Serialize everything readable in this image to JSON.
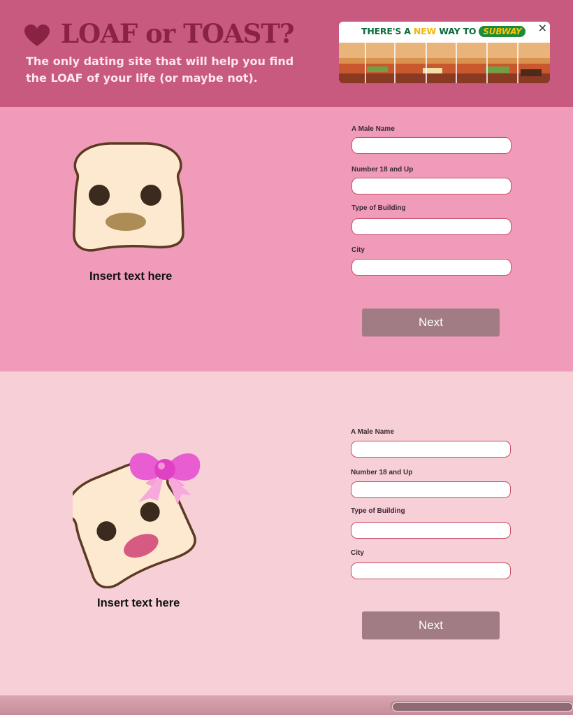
{
  "header": {
    "title": "LOAF or TOAST?",
    "tagline": "The only dating site that will help you find the LOAF of your life (or maybe not)."
  },
  "ad": {
    "headline_part1": "THERE'S A ",
    "headline_new": "NEW",
    "headline_part2": " WAY TO",
    "brand": "SUBWAY",
    "close_label": "×"
  },
  "forms": [
    {
      "caption": "Insert text here",
      "fields": [
        {
          "label": "A Male Name",
          "value": ""
        },
        {
          "label": "Number 18 and Up",
          "value": ""
        },
        {
          "label": "Type of Building",
          "value": ""
        },
        {
          "label": "City",
          "value": ""
        }
      ],
      "button_label": "Next"
    },
    {
      "caption": "Insert text here",
      "fields": [
        {
          "label": "A Male Name",
          "value": ""
        },
        {
          "label": "Number 18 and Up",
          "value": ""
        },
        {
          "label": "Type of Building",
          "value": ""
        },
        {
          "label": "City",
          "value": ""
        }
      ],
      "button_label": "Next"
    }
  ],
  "colors": {
    "header_bg": "#c85a80",
    "title": "#8a2244",
    "section_1_bg": "#f19bbb",
    "section_2_bg": "#f7cfd6",
    "button_bg": "#a17c84",
    "input_border": "#c84c64",
    "ad_brand_green": "#1e8a3c",
    "ad_brand_yellow": "#ffc600"
  },
  "icons": {
    "logo": "heart-icon",
    "ad_close": "close-icon",
    "character_1": "toast-boy-icon",
    "character_2": "toast-girl-with-bow-icon"
  }
}
